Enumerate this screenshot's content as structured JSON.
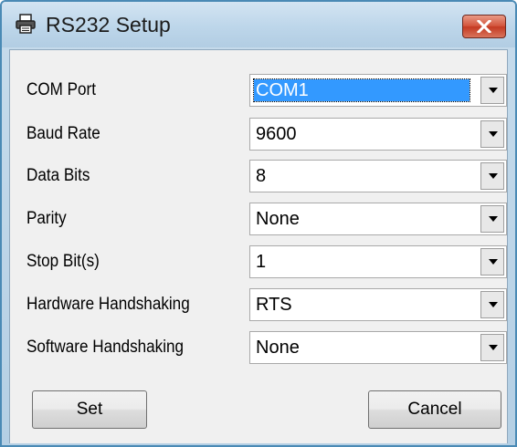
{
  "window": {
    "title": "RS232 Setup",
    "icon": "printer-icon",
    "close_icon": "close-icon",
    "close_button_color": "#c43a22"
  },
  "fields": [
    {
      "id": "com-port",
      "label": "COM Port",
      "value": "COM1",
      "focused": true
    },
    {
      "id": "baud-rate",
      "label": "Baud Rate",
      "value": "9600"
    },
    {
      "id": "data-bits",
      "label": "Data Bits",
      "value": "8"
    },
    {
      "id": "parity",
      "label": "Parity",
      "value": "None"
    },
    {
      "id": "stop-bits",
      "label": "Stop Bit(s)",
      "value": "1"
    },
    {
      "id": "hardware-handshaking",
      "label": "Hardware Handshaking",
      "value": "RTS"
    },
    {
      "id": "software-handshaking",
      "label": "Software Handshaking",
      "value": "None"
    }
  ],
  "buttons": {
    "set": "Set",
    "cancel": "Cancel"
  },
  "colors": {
    "selection_highlight": "#3399ff",
    "dialog_background": "#f0f0f0"
  }
}
